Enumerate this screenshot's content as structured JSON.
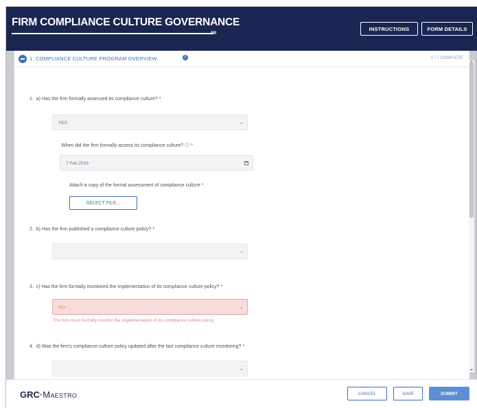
{
  "header": {
    "title": "FIRM COMPLIANCE CULTURE GOVERNANCE",
    "subtitle_tag": "PR",
    "buttons": {
      "instructions": "INSTRUCTIONS",
      "form_details": "FORM DETAILS"
    }
  },
  "section": {
    "title": "1. COMPLIANCE CULTURE PROGRAM OVERVIEW",
    "status": "0 / 7 COMPLETE"
  },
  "questions": [
    {
      "number": "1.",
      "text": "a) Has the firm formally assessed its compliance culture? *",
      "value": "YES"
    },
    {
      "text": "When did the firm formally assess its compliance culture? ⓘ *",
      "value": "7 Feb 2019"
    },
    {
      "text": "Attach a copy of the formal assessment of compliance culture *",
      "button": "SELECT FILE..."
    },
    {
      "number": "2.",
      "text": "b) Has the firm published a compliance culture policy? *",
      "value": ""
    },
    {
      "number": "3.",
      "text": "c) Has the firm formally monitored the implementation of its compliance culture policy? *",
      "value": "NO",
      "error": "The firm must formally monitor the implementation of its compliance culture policy"
    },
    {
      "number": "4.",
      "text": "d) Was the firm's compliance culture policy updated after the last compliance culture monitoring? *",
      "value": ""
    }
  ],
  "footer": {
    "logo_left": "GRC",
    "logo_sep": "·",
    "logo_right": "Maestro",
    "cancel": "CANCEL",
    "save": "SAVE",
    "submit": "SUBMIT"
  },
  "colors": {
    "header_bg": "#1b2552",
    "accent": "#3d6fb8",
    "submit": "#5b8fd6",
    "error_bg": "#f8dcdc",
    "error_text": "#e08686",
    "logo_dot": "#c22a2a"
  }
}
